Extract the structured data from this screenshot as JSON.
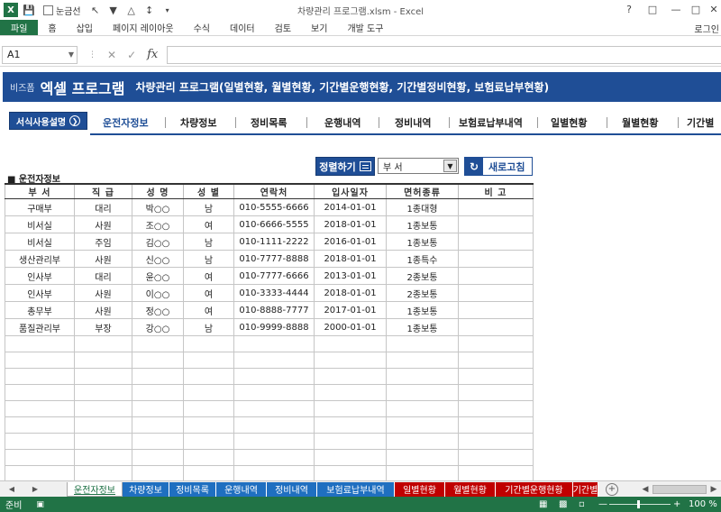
{
  "window": {
    "title": "차량관리 프로그램.xlsm - Excel",
    "qat_checkbox_label": "눈금선",
    "login": "로그인"
  },
  "ribbon": {
    "file": "파일",
    "tabs": [
      "홈",
      "삽입",
      "페이지 레이아웃",
      "수식",
      "데이터",
      "검토",
      "보기",
      "개발 도구"
    ]
  },
  "formula_bar": {
    "cell_ref": "A1",
    "fx": "fx",
    "value": ""
  },
  "banner": {
    "brand": "비즈폼",
    "program": "엑셀 프로그램",
    "description": "차량관리 프로그램(일별현황, 월별현황, 기간별운행현황, 기간별정비현황, 보험료납부현황)"
  },
  "nav": {
    "help_label": "서식사용설명",
    "items": [
      "운전자정보",
      "차량정보",
      "정비목록",
      "운행내역",
      "정비내역",
      "보험료납부내역",
      "일별현황",
      "월별현황",
      "기간별"
    ]
  },
  "controls": {
    "sort_label": "정렬하기",
    "sort_value": "부 서",
    "refresh_label": "새로고침"
  },
  "section_title": "■ 운전자정보",
  "table": {
    "headers": [
      "부 서",
      "직 급",
      "성 명",
      "성 별",
      "연락처",
      "입사일자",
      "면허종류",
      "비 고"
    ],
    "rows": [
      [
        "구매부",
        "대리",
        "박○○",
        "남",
        "010-5555-6666",
        "2014-01-01",
        "1종대형",
        ""
      ],
      [
        "비서실",
        "사원",
        "조○○",
        "여",
        "010-6666-5555",
        "2018-01-01",
        "1종보통",
        ""
      ],
      [
        "비서실",
        "주임",
        "김○○",
        "남",
        "010-1111-2222",
        "2016-01-01",
        "1종보통",
        ""
      ],
      [
        "생산관리부",
        "사원",
        "신○○",
        "남",
        "010-7777-8888",
        "2018-01-01",
        "1종특수",
        ""
      ],
      [
        "인사부",
        "대리",
        "윤○○",
        "여",
        "010-7777-6666",
        "2013-01-01",
        "2종보통",
        ""
      ],
      [
        "인사부",
        "사원",
        "이○○",
        "여",
        "010-3333-4444",
        "2018-01-01",
        "2종보통",
        ""
      ],
      [
        "총무부",
        "사원",
        "정○○",
        "여",
        "010-8888-7777",
        "2017-01-01",
        "1종보통",
        ""
      ],
      [
        "품질관리부",
        "부장",
        "강○○",
        "남",
        "010-9999-8888",
        "2000-01-01",
        "1종보통",
        ""
      ]
    ]
  },
  "sheet_tabs": [
    {
      "label": "운전자정보",
      "color": "#ffffff"
    },
    {
      "label": "차량정보",
      "color": "#1f6fc0"
    },
    {
      "label": "정비목록",
      "color": "#1f6fc0"
    },
    {
      "label": "운행내역",
      "color": "#1f6fc0"
    },
    {
      "label": "정비내역",
      "color": "#1f6fc0"
    },
    {
      "label": "보험료납부내역",
      "color": "#1f6fc0"
    },
    {
      "label": "일별현황",
      "color": "#c00000"
    },
    {
      "label": "월별현황",
      "color": "#c00000"
    },
    {
      "label": "기간별운행현황",
      "color": "#c00000"
    },
    {
      "label": "기간별",
      "color": "#c00000"
    }
  ],
  "status": {
    "ready": "준비",
    "zoom": "100 %"
  },
  "colors": {
    "excel_green": "#217346",
    "banner_blue": "#1f4e96"
  }
}
